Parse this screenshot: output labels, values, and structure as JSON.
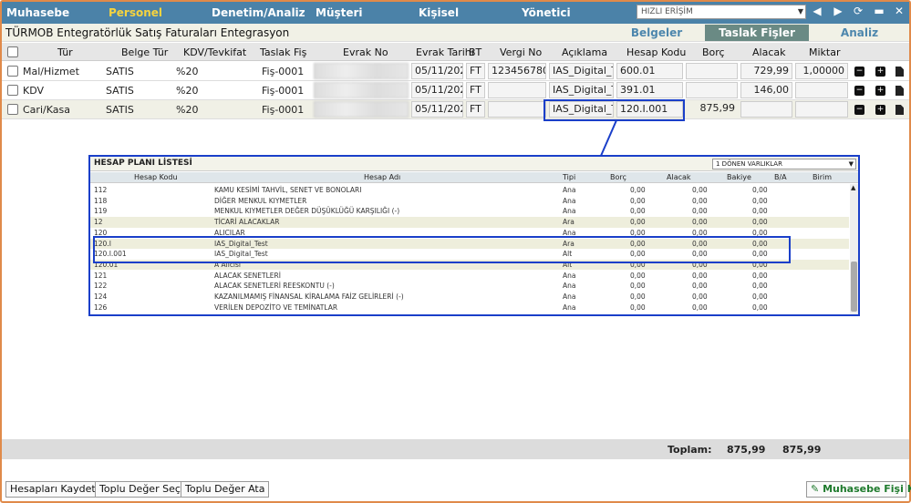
{
  "menu": {
    "items": [
      "Muhasebe",
      "Personel",
      "Denetim/Analiz",
      "Müşteri",
      "Kişisel",
      "Yönetici"
    ],
    "active": "Personel",
    "quick_access": "HIZLI ERİŞİM"
  },
  "title": "TÜRMOB Entegratörlük Satış Faturaları Entegrasyon",
  "tabs": [
    "Belgeler",
    "Taslak Fişler",
    "Analiz"
  ],
  "headers": [
    "Tür",
    "Belge Tür",
    "KDV/Tevkifat",
    "Taslak Fiş",
    "Evrak No",
    "Evrak Tarihi",
    "BT",
    "Vergi No",
    "Açıklama",
    "Hesap Kodu",
    "Borç",
    "Alacak",
    "Miktar"
  ],
  "rows": [
    {
      "tur": "Mal/Hizmet",
      "belge": "SATIS",
      "kdv": "%20",
      "fis": "Fiş-0001",
      "evrak": "XXXXXXXXXXXXX",
      "tarih": "05/11/2024",
      "bt": "FT",
      "vergi": "1234567801",
      "aciklama": "IAS_Digital_Test",
      "hesap": "600.01",
      "borc": "",
      "alacak": "729,99",
      "miktar": "1,00000"
    },
    {
      "tur": "KDV",
      "belge": "SATIS",
      "kdv": "%20",
      "fis": "Fiş-0001",
      "evrak": "XXXXXXXXXXXXX",
      "tarih": "05/11/2024",
      "bt": "FT",
      "vergi": "",
      "aciklama": "IAS_Digital_Test",
      "hesap": "391.01",
      "borc": "",
      "alacak": "146,00",
      "miktar": ""
    },
    {
      "tur": "Cari/Kasa",
      "belge": "SATIS",
      "kdv": "%20",
      "fis": "Fiş-0001",
      "evrak": "XXXXXXXXXXXXX",
      "tarih": "05/11/2024",
      "bt": "FT",
      "vergi": "",
      "aciklama": "IAS_Digital_Test",
      "hesap": "120.I.001",
      "borc": "875,99",
      "alacak": "",
      "miktar": ""
    }
  ],
  "popup": {
    "title": "HESAP PLANI LİSTESİ",
    "selected": "1 DÖNEN VARLIKLAR",
    "headers": [
      "Hesap Kodu",
      "Hesap Adı",
      "Tipi",
      "Borç",
      "Alacak",
      "Bakiye",
      "B/A",
      "Birim"
    ],
    "rows": [
      {
        "kod": "112",
        "ad": "KAMU KESİMİ TAHVİL, SENET VE BONOLARI",
        "tip": "Ana",
        "borc": "0,00",
        "alacak": "0,00",
        "bakiye": "0,00"
      },
      {
        "kod": "118",
        "ad": "DİĞER MENKUL KIYMETLER",
        "tip": "Ana",
        "borc": "0,00",
        "alacak": "0,00",
        "bakiye": "0,00"
      },
      {
        "kod": "119",
        "ad": "MENKUL KIYMETLER DEĞER DÜŞÜKLÜĞÜ KARŞILIĞI (-)",
        "tip": "Ana",
        "borc": "0,00",
        "alacak": "0,00",
        "bakiye": "0,00"
      },
      {
        "kod": "12",
        "ad": "TİCARİ ALACAKLAR",
        "tip": "Ara",
        "borc": "0,00",
        "alacak": "0,00",
        "bakiye": "0,00"
      },
      {
        "kod": "120",
        "ad": "ALICILAR",
        "tip": "Ana",
        "borc": "0,00",
        "alacak": "0,00",
        "bakiye": "0,00"
      },
      {
        "kod": "120.I",
        "ad": "IAS_Digital_Test",
        "tip": "Ara",
        "borc": "0,00",
        "alacak": "0,00",
        "bakiye": "0,00"
      },
      {
        "kod": "120.I.001",
        "ad": "IAS_Digital_Test",
        "tip": "Alt",
        "borc": "0,00",
        "alacak": "0,00",
        "bakiye": "0,00"
      },
      {
        "kod": "120.01",
        "ad": "A Alıcısı",
        "tip": "Alt",
        "borc": "0,00",
        "alacak": "0,00",
        "bakiye": "0,00"
      },
      {
        "kod": "121",
        "ad": "ALACAK SENETLERİ",
        "tip": "Ana",
        "borc": "0,00",
        "alacak": "0,00",
        "bakiye": "0,00"
      },
      {
        "kod": "122",
        "ad": "ALACAK SENETLERİ REESKONTU (-)",
        "tip": "Ana",
        "borc": "0,00",
        "alacak": "0,00",
        "bakiye": "0,00"
      },
      {
        "kod": "124",
        "ad": "KAZANILMAMIŞ FİNANSAL KİRALAMA FAİZ GELİRLERİ (-)",
        "tip": "Ana",
        "borc": "0,00",
        "alacak": "0,00",
        "bakiye": "0,00"
      },
      {
        "kod": "126",
        "ad": "VERİLEN DEPOZİTO VE TEMİNATLAR",
        "tip": "Ana",
        "borc": "0,00",
        "alacak": "0,00",
        "bakiye": "0,00"
      }
    ]
  },
  "totals": {
    "label": "Toplam:",
    "borc": "875,99",
    "alacak": "875,99"
  },
  "buttons": {
    "save": "Hesapları Kaydet",
    "bulk_select": "Toplu Değer Seç",
    "bulk_assign": "Toplu Değer Ata",
    "fis_kes": "Muhasebe Fişi Kes"
  },
  "colors": {
    "menu": "#4b82a8",
    "active": "#f5d33f",
    "highlight": "#1a3fc9",
    "accent": "#e08a4a"
  }
}
